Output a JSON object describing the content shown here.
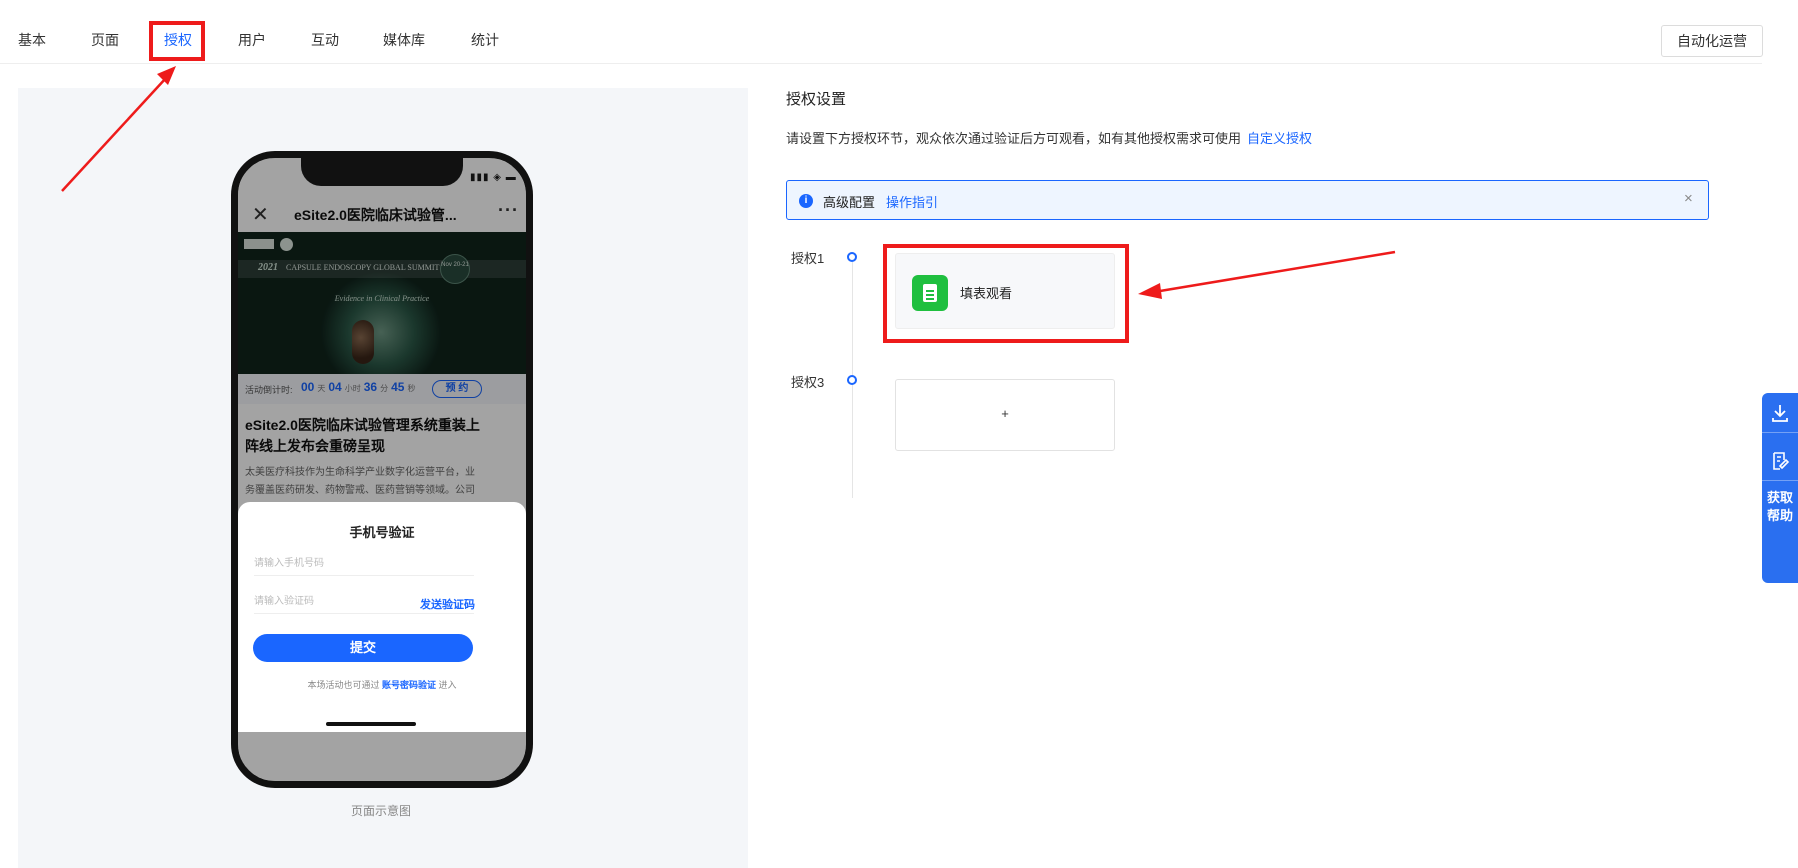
{
  "tabs": [
    {
      "label": "基本"
    },
    {
      "label": "页面"
    },
    {
      "label": "授权"
    },
    {
      "label": "用户"
    },
    {
      "label": "互动"
    },
    {
      "label": "媒体库"
    },
    {
      "label": "统计"
    }
  ],
  "active_tab": "授权",
  "header": {
    "automation_button": "自动化运营"
  },
  "preview": {
    "caption": "页面示意图",
    "phone": {
      "status_icons": "▮▮▮ ◈ ▬",
      "nav_title": "eSite2.0医院临床试验管...",
      "banner": {
        "year": "2021",
        "summit": "CAPSULE ENDOSCOPY GLOBAL SUMMIT",
        "date_line1": "Nov 20-21",
        "tagline": "Evidence in Clinical Practice"
      },
      "countdown": {
        "label": "活动倒计时:",
        "days": "00",
        "days_unit": "天",
        "hours": "04",
        "hours_unit": "小时",
        "minutes": "36",
        "minutes_unit": "分",
        "seconds": "45",
        "seconds_unit": "秒",
        "reserve_button": "预 约"
      },
      "headline": "eSite2.0医院临床试验管理系统重装上阵线上发布会重磅呈现",
      "description": "太美医疗科技作为生命科学产业数字化运营平台，业务覆盖医药研发、药物警戒、医药营销等领域。公司自主研发",
      "verify_sheet": {
        "title": "手机号验证",
        "phone_placeholder": "请输入手机号码",
        "code_placeholder": "请输入验证码",
        "send_code": "发送验证码",
        "submit": "提交",
        "note_prefix": "本场活动也可通过",
        "note_link": "账号密码验证",
        "note_suffix": "进入"
      }
    }
  },
  "auth": {
    "title": "授权设置",
    "description": "请设置下方授权环节，观众依次通过验证后方可观看，如有其他授权需求可使用",
    "custom_link": "自定义授权",
    "notice": {
      "text": "高级配置",
      "link": "操作指引",
      "info_icon": "i",
      "close": "×"
    },
    "steps": [
      {
        "label": "授权1",
        "card": "填表观看"
      },
      {
        "label": "授权3",
        "card": "+"
      }
    ]
  },
  "side_panel": {
    "help": "获取帮助"
  },
  "colors": {
    "accent": "#1a66ff",
    "highlight": "#ee1b1b",
    "form_icon": "#1fbf3f",
    "side_panel": "#2a6ff0"
  }
}
